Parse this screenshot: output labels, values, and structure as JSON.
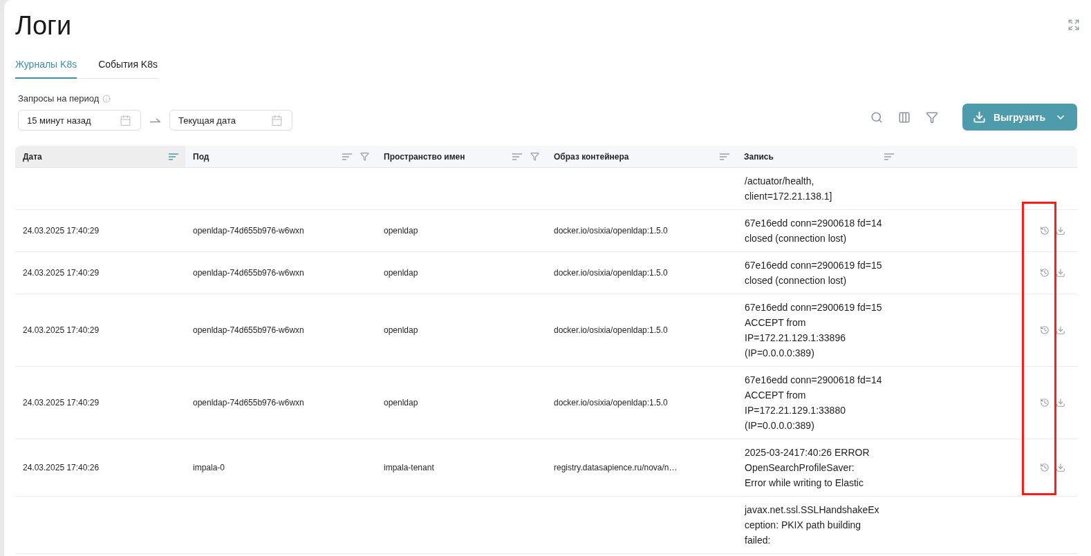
{
  "page": {
    "title": "Логи"
  },
  "tabs": [
    {
      "label": "Журналы K8s",
      "selected": true
    },
    {
      "label": "События K8s",
      "selected": false
    }
  ],
  "period": {
    "label": "Запросы на период",
    "from": "15 минут назад",
    "to": "Текущая дата"
  },
  "export_button": {
    "label": "Выгрузить"
  },
  "table": {
    "columns": [
      {
        "label": "Дата",
        "sorted": true,
        "filter": false
      },
      {
        "label": "Под",
        "sorted": false,
        "filter": true
      },
      {
        "label": "Пространство имен",
        "sorted": false,
        "filter": true
      },
      {
        "label": "Образ контейнера",
        "sorted": false,
        "filter": false
      },
      {
        "label": "Запись",
        "sorted": false,
        "filter": false
      }
    ],
    "rows": [
      {
        "record": [
          "/actuator/health,",
          "client=172.21.138.1]"
        ]
      },
      {
        "date": "24.03.2025 17:40:29",
        "pod": "openldap-74d655b976-w6wxn",
        "namespace": "openldap",
        "image": "docker.io/osixia/openldap:1.5.0",
        "record": [
          "67e16edd conn=2900618 fd=14",
          "closed (connection lost)"
        ]
      },
      {
        "date": "24.03.2025 17:40:29",
        "pod": "openldap-74d655b976-w6wxn",
        "namespace": "openldap",
        "image": "docker.io/osixia/openldap:1.5.0",
        "record": [
          "67e16edd conn=2900619 fd=15",
          "closed (connection lost)"
        ]
      },
      {
        "date": "24.03.2025 17:40:29",
        "pod": "openldap-74d655b976-w6wxn",
        "namespace": "openldap",
        "image": "docker.io/osixia/openldap:1.5.0",
        "record": [
          "67e16edd conn=2900619 fd=15",
          "ACCEPT from",
          "IP=172.21.129.1:33896",
          "(IP=0.0.0.0:389)"
        ]
      },
      {
        "date": "24.03.2025 17:40:29",
        "pod": "openldap-74d655b976-w6wxn",
        "namespace": "openldap",
        "image": "docker.io/osixia/openldap:1.5.0",
        "record": [
          "67e16edd conn=2900618 fd=14",
          "ACCEPT from",
          "IP=172.21.129.1:33880",
          "(IP=0.0.0.0:389)"
        ]
      },
      {
        "date": "24.03.2025 17:40:26",
        "pod": "impala-0",
        "namespace": "impala-tenant",
        "image": "registry.datasapience.ru/nova/n…",
        "record": [
          "2025-03-2417:40:26 ERROR",
          "OpenSearchProfileSaver:",
          "Error while writing to Elastic"
        ]
      },
      {
        "record": [
          "javax.net.ssl.SSLHandshakeEx",
          "ception: PKIX path building",
          "failed:"
        ]
      }
    ]
  }
}
